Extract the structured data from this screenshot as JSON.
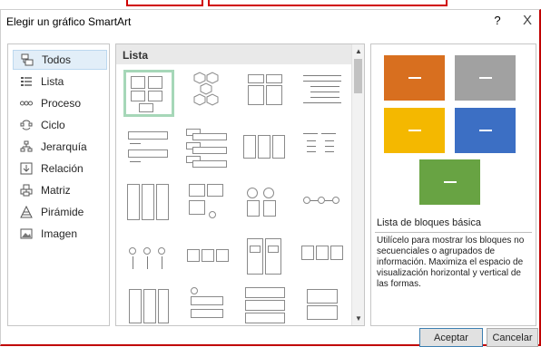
{
  "dialog": {
    "title": "Elegir un gráfico SmartArt",
    "help_label": "?",
    "close_label": "X"
  },
  "categories": [
    {
      "label": "Todos",
      "icon": "all-icon",
      "selected": true
    },
    {
      "label": "Lista",
      "icon": "list-icon"
    },
    {
      "label": "Proceso",
      "icon": "process-icon"
    },
    {
      "label": "Ciclo",
      "icon": "cycle-icon"
    },
    {
      "label": "Jerarquía",
      "icon": "hierarchy-icon"
    },
    {
      "label": "Relación",
      "icon": "relationship-icon"
    },
    {
      "label": "Matriz",
      "icon": "matrix-icon"
    },
    {
      "label": "Pirámide",
      "icon": "pyramid-icon"
    },
    {
      "label": "Imagen",
      "icon": "picture-icon"
    }
  ],
  "gallery": {
    "heading": "Lista"
  },
  "preview": {
    "name": "Lista de bloques básica",
    "description": "Utilícelo para mostrar los bloques no secuenciales o agrupados de información. Maximiza el espacio de visualización horizontal y vertical de las formas.",
    "colors": [
      "#d86f1f",
      "#a1a1a1",
      "#f4b800",
      "#3c6fc4",
      "#68a343"
    ]
  },
  "buttons": {
    "ok": "Aceptar",
    "cancel": "Cancelar"
  }
}
